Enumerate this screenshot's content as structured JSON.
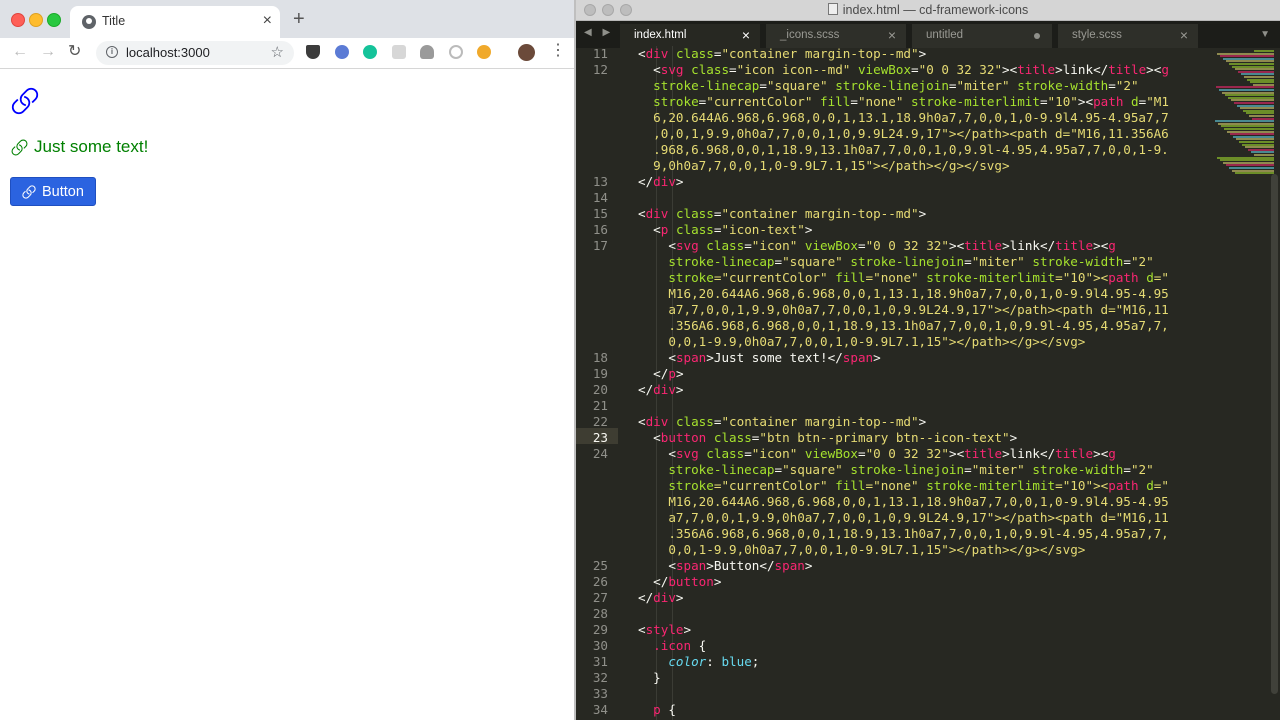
{
  "browser": {
    "tab_title": "Title",
    "url": "localhost:3000",
    "page": {
      "text": "Just some text!",
      "button_label": "Button"
    }
  },
  "editor": {
    "window_title": "index.html — cd-framework-icons",
    "tabs": [
      {
        "label": "index.html",
        "state": "active"
      },
      {
        "label": "_icons.scss",
        "state": "close"
      },
      {
        "label": "untitled",
        "state": "unsaved"
      },
      {
        "label": "style.scss",
        "state": "close"
      }
    ],
    "gutter": [
      {
        "n": "11",
        "row": 0
      },
      {
        "n": "12",
        "row": 1
      },
      {
        "n": "13",
        "row": 8
      },
      {
        "n": "14",
        "row": 9
      },
      {
        "n": "15",
        "row": 10
      },
      {
        "n": "16",
        "row": 11
      },
      {
        "n": "17",
        "row": 12
      },
      {
        "n": "18",
        "row": 19
      },
      {
        "n": "19",
        "row": 20
      },
      {
        "n": "20",
        "row": 21
      },
      {
        "n": "21",
        "row": 22
      },
      {
        "n": "22",
        "row": 23
      },
      {
        "n": "23",
        "row": 24
      },
      {
        "n": "24",
        "row": 25
      },
      {
        "n": "25",
        "row": 32
      },
      {
        "n": "26",
        "row": 33
      },
      {
        "n": "27",
        "row": 34
      },
      {
        "n": "28",
        "row": 35
      },
      {
        "n": "29",
        "row": 36
      },
      {
        "n": "30",
        "row": 37
      },
      {
        "n": "31",
        "row": 38
      },
      {
        "n": "32",
        "row": 39
      },
      {
        "n": "33",
        "row": 40
      },
      {
        "n": "34",
        "row": 41
      }
    ],
    "code_rows": [
      "<div class=\"container margin-top--md\">",
      "  <svg class=\"icon icon--md\" viewBox=\"0 0 32 32\"><title>link</title><g",
      "  stroke-linecap=\"square\" stroke-linejoin=\"miter\" stroke-width=\"2\"",
      "  stroke=\"currentColor\" fill=\"none\" stroke-miterlimit=\"10\"><path d=\"M1",
      "  6,20.644A6.968,6.968,0,0,1,13.1,18.9h0a7,7,0,0,1,0-9.9l4.95-4.95a7,7",
      "  ,0,0,1,9.9,0h0a7,7,0,0,1,0,9.9L24.9,17\"></path><path d=\"M16,11.356A6",
      "  .968,6.968,0,0,1,18.9,13.1h0a7,7,0,0,1,0,9.9l-4.95,4.95a7,7,0,0,1-9.",
      "  9,0h0a7,7,0,0,1,0-9.9L7.1,15\"></path></g></svg>",
      "</div>",
      "",
      "<div class=\"container margin-top--md\">",
      "  <p class=\"icon-text\">",
      "    <svg class=\"icon\" viewBox=\"0 0 32 32\"><title>link</title><g",
      "    stroke-linecap=\"square\" stroke-linejoin=\"miter\" stroke-width=\"2\"",
      "    stroke=\"currentColor\" fill=\"none\" stroke-miterlimit=\"10\"><path d=\"",
      "    M16,20.644A6.968,6.968,0,0,1,13.1,18.9h0a7,7,0,0,1,0-9.9l4.95-4.95",
      "    a7,7,0,0,1,9.9,0h0a7,7,0,0,1,0,9.9L24.9,17\"></path><path d=\"M16,11",
      "    .356A6.968,6.968,0,0,1,18.9,13.1h0a7,7,0,0,1,0,9.9l-4.95,4.95a7,7,",
      "    0,0,1-9.9,0h0a7,7,0,0,1,0-9.9L7.1,15\"></path></g></svg>",
      "    <span>Just some text!</span>",
      "  </p>",
      "</div>",
      "",
      "<div class=\"container margin-top--md\">",
      "  <button class=\"btn btn--primary btn--icon-text\">",
      "    <svg class=\"icon\" viewBox=\"0 0 32 32\"><title>link</title><g",
      "    stroke-linecap=\"square\" stroke-linejoin=\"miter\" stroke-width=\"2\"",
      "    stroke=\"currentColor\" fill=\"none\" stroke-miterlimit=\"10\"><path d=\"",
      "    M16,20.644A6.968,6.968,0,0,1,13.1,18.9h0a7,7,0,0,1,0-9.9l4.95-4.95",
      "    a7,7,0,0,1,9.9,0h0a7,7,0,0,1,0,9.9L24.9,17\"></path><path d=\"M16,11",
      "    .356A6.968,6.968,0,0,1,18.9,13.1h0a7,7,0,0,1,0,9.9l-4.95,4.95a7,7,",
      "    0,0,1-9.9,0h0a7,7,0,0,1,0-9.9L7.1,15\"></path></g></svg>",
      "    <span>Button</span>",
      "  </button>",
      "</div>",
      "",
      "<style>",
      "  .icon {",
      "    color: blue;",
      "  }",
      "",
      "  p {"
    ],
    "current_line": "23"
  },
  "colors": {
    "icon_blue": "#0000ff",
    "text_green": "#008000",
    "button_blue": "#2b63e0"
  }
}
